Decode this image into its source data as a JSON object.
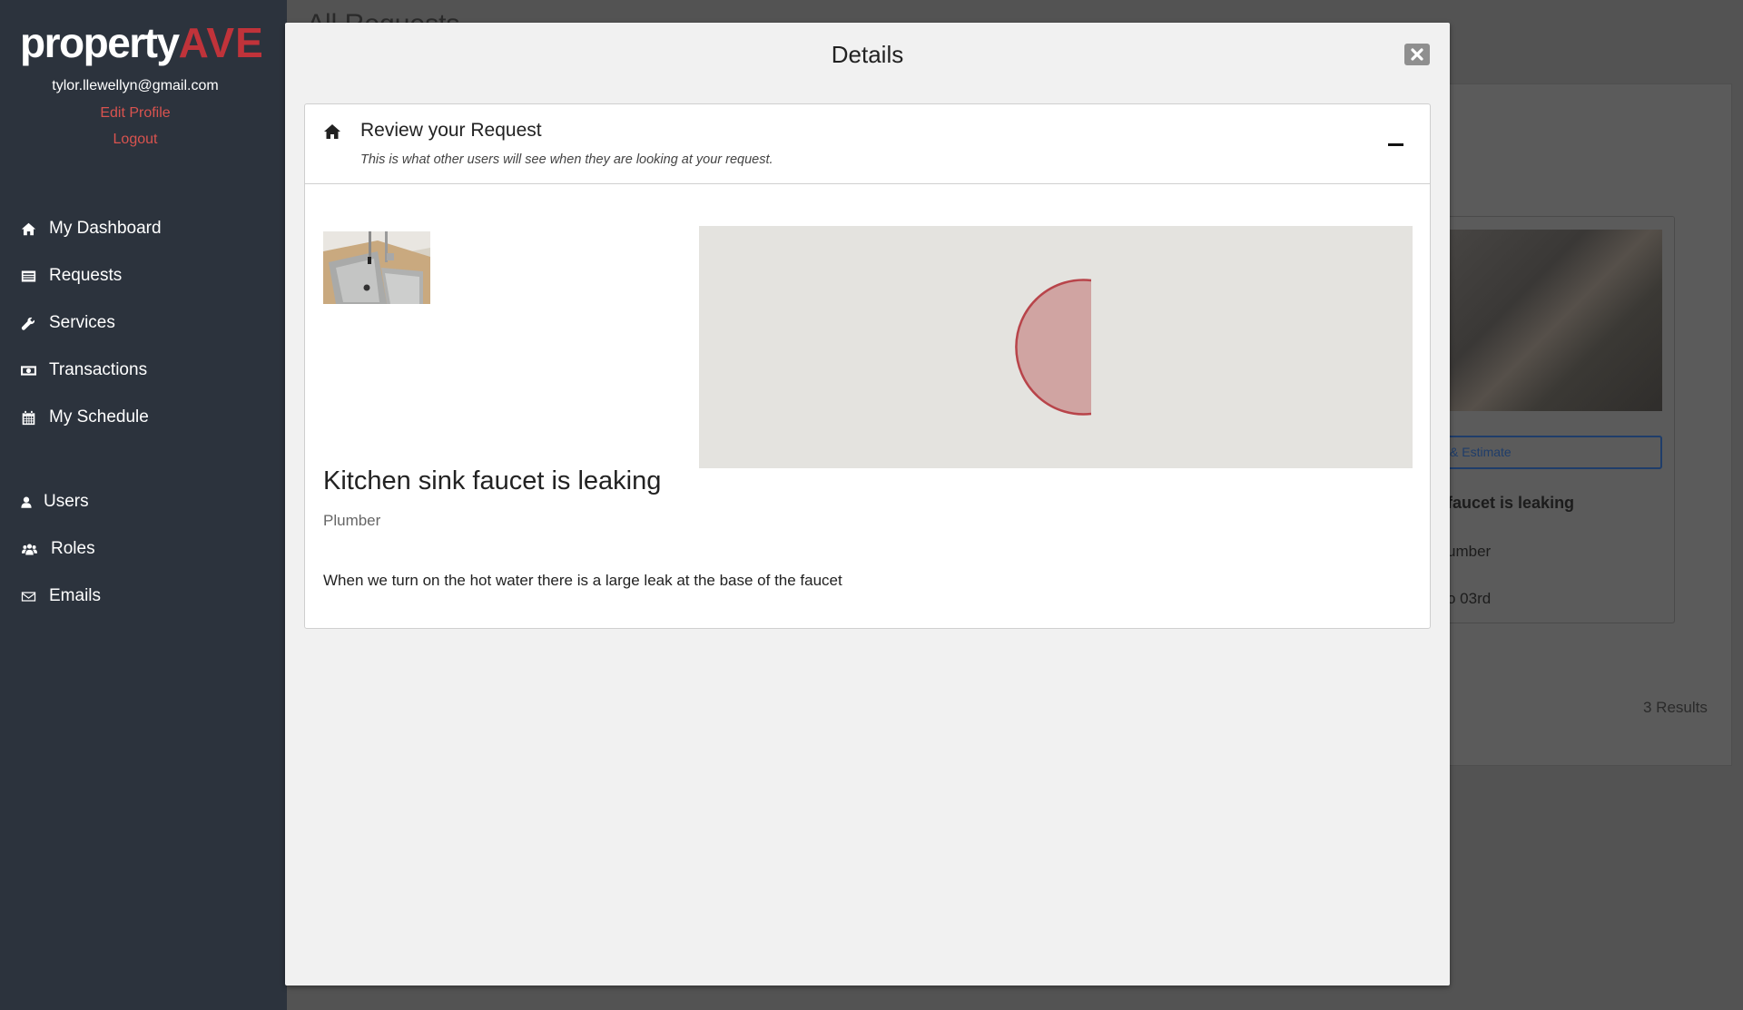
{
  "sidebar": {
    "logo": {
      "part1": "property",
      "part2": "AVE"
    },
    "user_email": "tylor.llewellyn@gmail.com",
    "edit_profile": "Edit Profile",
    "logout": "Logout",
    "nav": [
      {
        "label": "My Dashboard",
        "icon": "home-icon"
      },
      {
        "label": "Requests",
        "icon": "list-icon"
      },
      {
        "label": "Services",
        "icon": "wrench-icon"
      },
      {
        "label": "Transactions",
        "icon": "money-icon"
      },
      {
        "label": "My Schedule",
        "icon": "calendar-icon"
      },
      {
        "label": "Users",
        "icon": "user-icon"
      },
      {
        "label": "Roles",
        "icon": "users-icon"
      },
      {
        "label": "Emails",
        "icon": "envelope-icon"
      }
    ]
  },
  "background": {
    "page_title": "All Requests",
    "card_button": "& Estimate",
    "card_title": "faucet is leaking",
    "card_category": "umber",
    "card_date": "o 03rd",
    "results": "3 Results"
  },
  "modal": {
    "title": "Details",
    "close_icon": "close-icon",
    "card": {
      "title": "Review your Request",
      "subtitle": "This is what other users will see when they are looking at your request.",
      "request_title": "Kitchen sink faucet is leaking",
      "category": "Plumber",
      "description": "When we turn on the hot water there is a large leak at the base of the faucet"
    }
  },
  "colors": {
    "sidebar_bg": "#2c333d",
    "accent_red": "#c0333a",
    "link_red": "#d9534f",
    "overlay": "#535353",
    "map_bg": "#e4e3df",
    "map_marker_fill": "#d0a4a2",
    "map_marker_stroke": "#b8444a"
  }
}
